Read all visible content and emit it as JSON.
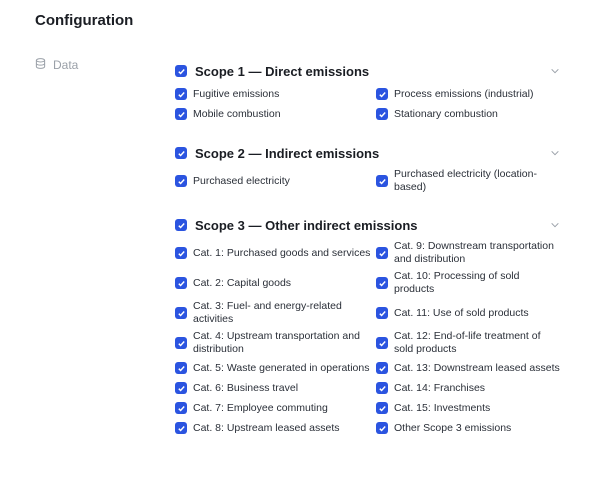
{
  "page": {
    "title": "Configuration"
  },
  "nav": {
    "data_label": "Data"
  },
  "scopes": [
    {
      "title": "Scope 1 — Direct emissions",
      "items": [
        "Fugitive emissions",
        "Process emissions (industrial)",
        "Mobile combustion",
        "Stationary combustion"
      ]
    },
    {
      "title": "Scope 2 — Indirect emissions",
      "items": [
        "Purchased electricity",
        "Purchased electricity (location-based)"
      ]
    },
    {
      "title": "Scope 3 — Other indirect emissions",
      "items": [
        "Cat. 1: Purchased goods and services",
        "Cat. 9: Downstream transportation and distribution",
        "Cat. 2: Capital goods",
        "Cat. 10: Processing of sold products",
        "Cat. 3: Fuel- and energy-related activities",
        "Cat. 11: Use of sold products",
        "Cat. 4: Upstream transportation and distribution",
        "Cat. 12: End-of-life treatment of sold products",
        "Cat. 5: Waste generated in operations",
        "Cat. 13: Downstream leased assets",
        "Cat. 6: Business travel",
        "Cat. 14: Franchises",
        "Cat. 7: Employee commuting",
        "Cat. 15: Investments",
        "Cat. 8: Upstream leased assets",
        "Other Scope 3 emissions"
      ]
    }
  ],
  "colors": {
    "accent": "#2b54e0",
    "muted": "#9aa0a8"
  },
  "icons": {
    "nav": "database-icon",
    "checkbox": "checkmark-icon",
    "collapse": "chevron-down-icon"
  }
}
